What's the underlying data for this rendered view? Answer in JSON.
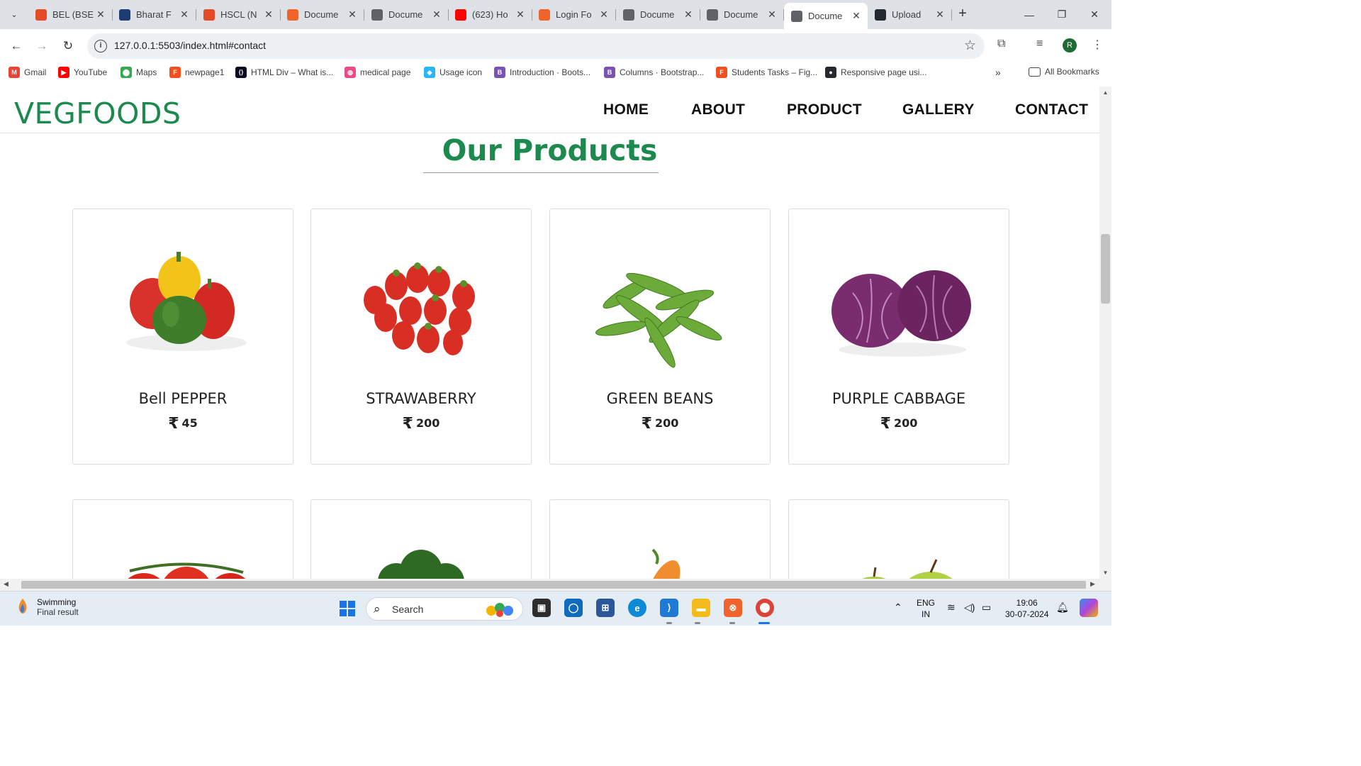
{
  "browser": {
    "tabs": [
      {
        "title": "BEL (BSE",
        "favicon_color": "#e34c26"
      },
      {
        "title": "Bharat F",
        "favicon_color": "#1f3b73"
      },
      {
        "title": "HSCL (N",
        "favicon_color": "#e34c26"
      },
      {
        "title": "Docume",
        "favicon_color": "#f0642c"
      },
      {
        "title": "Docume",
        "favicon_color": "#5f6368"
      },
      {
        "title": "(623) Ho",
        "favicon_color": "#ff0000"
      },
      {
        "title": "Login Fo",
        "favicon_color": "#f0642c"
      },
      {
        "title": "Docume",
        "favicon_color": "#5f6368"
      },
      {
        "title": "Docume",
        "favicon_color": "#5f6368"
      },
      {
        "title": "Docume",
        "favicon_color": "#5f6368"
      },
      {
        "title": "Upload",
        "favicon_color": "#24292f"
      }
    ],
    "active_tab_index": 9,
    "url": "127.0.0.1:5503/index.html#contact",
    "bookmarks": [
      {
        "label": "Gmail",
        "icon_color": "#ea4335",
        "icon": "M"
      },
      {
        "label": "YouTube",
        "icon_color": "#ff0000",
        "icon": "▶"
      },
      {
        "label": "Maps",
        "icon_color": "#34a853",
        "icon": "⬤"
      },
      {
        "label": "newpage1",
        "icon_color": "#f24e1e",
        "icon": "F"
      },
      {
        "label": "HTML Div – What is...",
        "icon_color": "#0a0a23",
        "icon": "⟨⟩"
      },
      {
        "label": "medical page",
        "icon_color": "#ea4c89",
        "icon": "◍"
      },
      {
        "label": "Usage icon",
        "icon_color": "#29b6f6",
        "icon": "◆"
      },
      {
        "label": "Introduction · Boots...",
        "icon_color": "#7952b3",
        "icon": "B"
      },
      {
        "label": "Columns · Bootstrap...",
        "icon_color": "#7952b3",
        "icon": "B"
      },
      {
        "label": "Students Tasks – Fig...",
        "icon_color": "#f24e1e",
        "icon": "F"
      },
      {
        "label": "Responsive page usi...",
        "icon_color": "#24292f",
        "icon": "●"
      }
    ],
    "all_bookmarks": "All Bookmarks",
    "profile_initial": "R"
  },
  "site": {
    "logo": "VEGFOODS",
    "nav": [
      "HOME",
      "ABOUT",
      "PRODUCT",
      "GALLERY",
      "CONTACT"
    ],
    "section_title": "Our Products",
    "currency_symbol": "₹",
    "products": [
      {
        "name": "Bell PEPPER",
        "price": "45",
        "image": "bell-pepper"
      },
      {
        "name": "STRAWABERRY",
        "price": "200",
        "image": "strawberry"
      },
      {
        "name": "GREEN BEANS",
        "price": "200",
        "image": "green-beans"
      },
      {
        "name": "PURPLE CABBAGE",
        "price": "200",
        "image": "purple-cabbage"
      }
    ],
    "next_row_images": [
      "tomato",
      "broccoli",
      "carrot",
      "apple"
    ]
  },
  "taskbar": {
    "weather_line1": "Swimming",
    "weather_line2": "Final result",
    "search_label": "Search",
    "lang_line1": "ENG",
    "lang_line2": "IN",
    "time": "19:06",
    "date": "30-07-2024"
  }
}
